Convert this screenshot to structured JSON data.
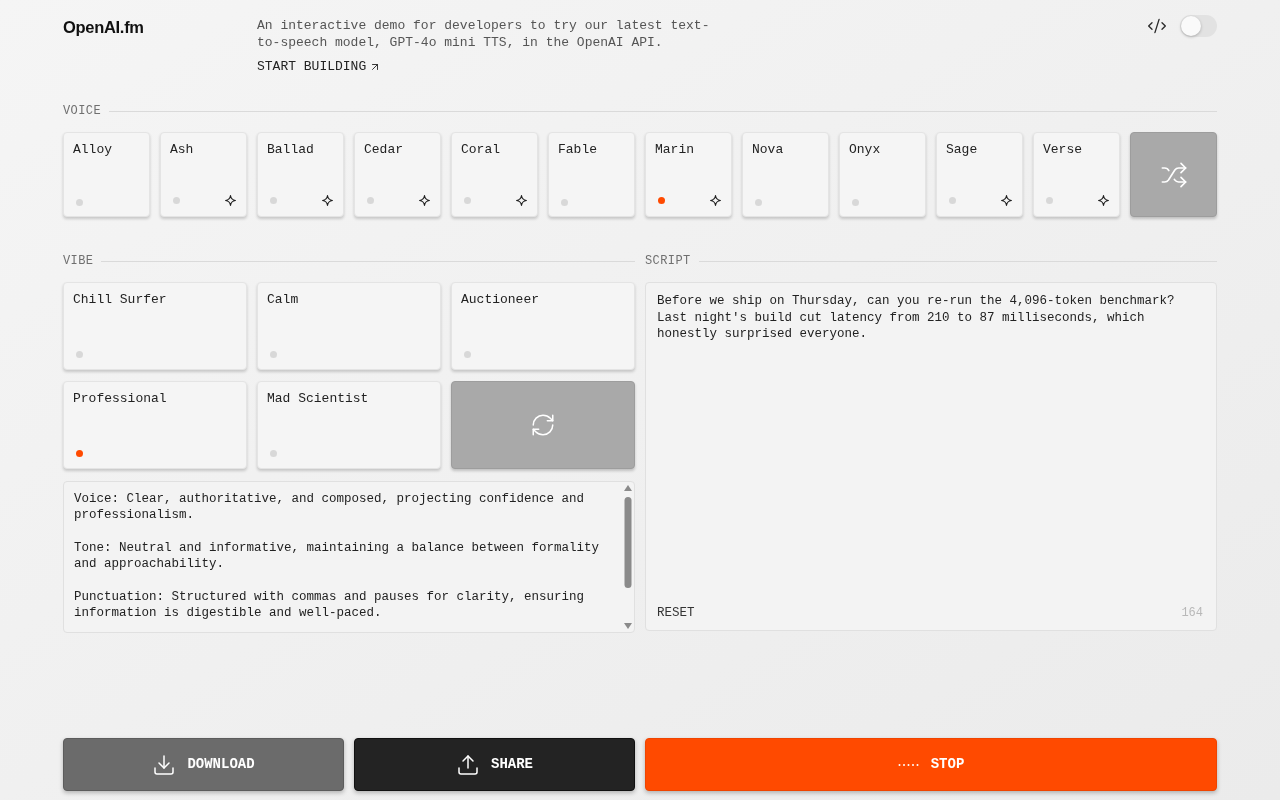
{
  "header": {
    "logo": "OpenAI.fm",
    "description": "An interactive demo for developers to try our latest text-to-speech model, GPT-4o mini TTS, in the OpenAI API.",
    "link": "START BUILDING",
    "code_toggle": {
      "on": false
    }
  },
  "voice": {
    "label": "VOICE",
    "options": [
      {
        "name": "Alloy",
        "selected": false,
        "sparkle": false
      },
      {
        "name": "Ash",
        "selected": false,
        "sparkle": true
      },
      {
        "name": "Ballad",
        "selected": false,
        "sparkle": true
      },
      {
        "name": "Cedar",
        "selected": false,
        "sparkle": true
      },
      {
        "name": "Coral",
        "selected": false,
        "sparkle": true
      },
      {
        "name": "Fable",
        "selected": false,
        "sparkle": false
      },
      {
        "name": "Marin",
        "selected": true,
        "sparkle": true
      },
      {
        "name": "Nova",
        "selected": false,
        "sparkle": false
      },
      {
        "name": "Onyx",
        "selected": false,
        "sparkle": false
      },
      {
        "name": "Sage",
        "selected": false,
        "sparkle": true
      },
      {
        "name": "Verse",
        "selected": false,
        "sparkle": true
      }
    ]
  },
  "vibe": {
    "label": "VIBE",
    "options": [
      {
        "name": "Chill Surfer",
        "selected": false
      },
      {
        "name": "Calm",
        "selected": false
      },
      {
        "name": "Auctioneer",
        "selected": false
      },
      {
        "name": "Professional",
        "selected": true
      },
      {
        "name": "Mad Scientist",
        "selected": false
      }
    ],
    "instructions": "Voice: Clear, authoritative, and composed, projecting confidence and professionalism.\n\nTone: Neutral and informative, maintaining a balance between formality and approachability.\n\nPunctuation: Structured with commas and pauses for clarity, ensuring information is digestible and well-paced."
  },
  "script": {
    "label": "SCRIPT",
    "text": "Before we ship on Thursday, can you re-run the 4,096-token benchmark? Last night's build cut latency from 210 to 87 milliseconds, which honestly surprised everyone.",
    "reset": "RESET",
    "count": "164"
  },
  "actions": [
    {
      "kind": "download",
      "label": "DOWNLOAD"
    },
    {
      "kind": "share",
      "label": "SHARE"
    },
    {
      "kind": "stop",
      "label": "STOP"
    }
  ]
}
